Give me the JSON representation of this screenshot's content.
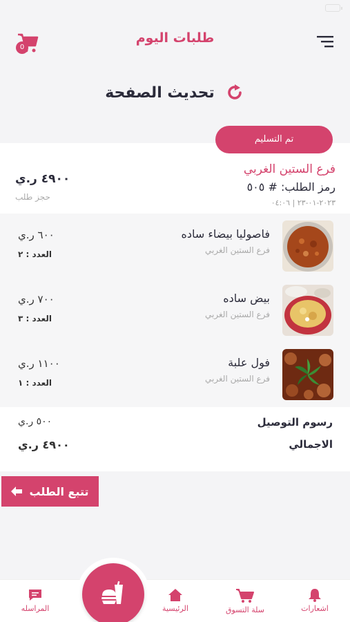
{
  "header": {
    "title": "طلبات اليوم",
    "cart_count": "0"
  },
  "refresh": {
    "label": "تحديث الصفحة"
  },
  "order": {
    "status": "تم التسليم",
    "branch": "فرع الستين الغربي",
    "code": "رمز الطلب: # ٥٠٥",
    "date": "٢٠٢٣-٠١-٢٣ | ٠٤:٠٦",
    "total": "٤٩٠٠ ر.ي",
    "type": "حجز طلب"
  },
  "items": [
    {
      "name": "فاصوليا بيضاء ساده",
      "branch": "فرع الستين الغربي",
      "price": "٦٠٠ ر.ي",
      "qty": "العدد : ٢",
      "image": "beans-dish"
    },
    {
      "name": "بيض ساده",
      "branch": "فرع الستين الغربي",
      "price": "٧٠٠ ر.ي",
      "qty": "العدد : ٣",
      "image": "eggs-dish"
    },
    {
      "name": "فول علبة",
      "branch": "فرع الستين الغربي",
      "price": "١١٠٠ ر.ي",
      "qty": "العدد : ١",
      "image": "fava-beans-dish"
    }
  ],
  "fees": {
    "delivery_label": "رسوم التوصيل",
    "delivery_value": "٥٠٠ ر.ي",
    "total_label": "الاجمالي",
    "total_value": "٤٩٠٠ ر.ي"
  },
  "track_button": {
    "label": "تتبع الطلب"
  },
  "tabs": [
    {
      "label": "المراسله",
      "icon": "chat-icon"
    },
    {
      "label": "الرئيسية",
      "icon": "home-icon"
    },
    {
      "label": "سلة التسوق",
      "icon": "cart-icon"
    },
    {
      "label": "اشعارات",
      "icon": "bell-icon"
    }
  ],
  "colors": {
    "accent": "#d4436d",
    "dark_text": "#2b2b3a"
  }
}
